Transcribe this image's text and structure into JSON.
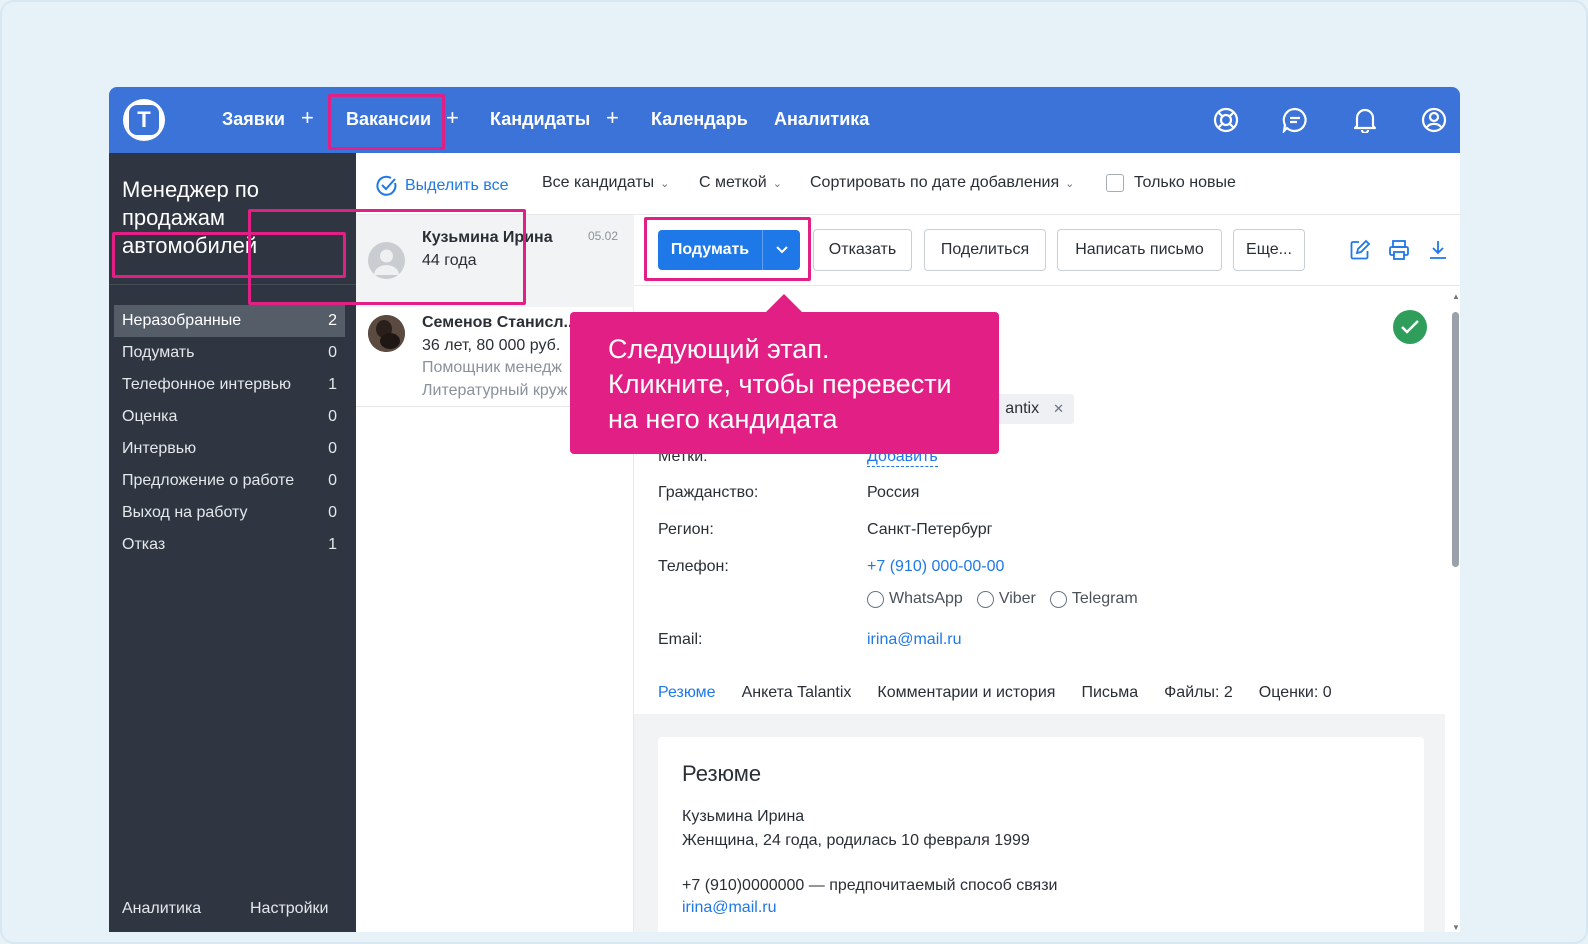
{
  "colors": {
    "accent": "#3b73d9",
    "primary_button": "#1f78e8",
    "highlight": "#e21f85",
    "sidebar": "#2f3641",
    "success": "#2f9e5b"
  },
  "logo": {
    "letter": "T"
  },
  "nav": {
    "items": [
      {
        "label": "Заявки"
      },
      {
        "label": "Вакансии"
      },
      {
        "label": "Кандидаты"
      },
      {
        "label": "Календарь"
      },
      {
        "label": "Аналитика"
      }
    ],
    "plus": "+",
    "icons": [
      "support-icon",
      "chat-icon",
      "bell-icon",
      "user-icon"
    ]
  },
  "sidebar": {
    "title": "Менеджер по продажам автомобилей",
    "stages": [
      {
        "label": "Неразобранные",
        "count": "2"
      },
      {
        "label": "Подумать",
        "count": "0"
      },
      {
        "label": "Телефонное интервью",
        "count": "1"
      },
      {
        "label": "Оценка",
        "count": "0"
      },
      {
        "label": "Интервью",
        "count": "0"
      },
      {
        "label": "Предложение о работе",
        "count": "0"
      },
      {
        "label": "Выход на работу",
        "count": "0"
      },
      {
        "label": "Отказ",
        "count": "1"
      }
    ],
    "footer": {
      "analytics": "Аналитика",
      "settings": "Настройки"
    }
  },
  "filters": {
    "select_all": "Выделить все",
    "all_candidates": "Все кандидаты",
    "with_tag": "С меткой",
    "sort": "Сортировать по дате добавления",
    "only_new": "Только новые"
  },
  "candidates": [
    {
      "name": "Кузьмина Ирина",
      "sub": "44 года",
      "date": "05.02"
    },
    {
      "name": "Семенов Станисл...",
      "sub": "36 лет, 80 000 руб.",
      "line3": "Помощник менедж",
      "line4": "Литературный круж"
    }
  ],
  "actions": {
    "primary": "Подумать",
    "reject": "Отказать",
    "share": "Поделиться",
    "write": "Написать письмо",
    "more": "Еще..."
  },
  "tooltip": {
    "line1": "Следующий этап.",
    "line2": "Кликните, чтобы перевести",
    "line3": "на него кандидата"
  },
  "detail": {
    "tag_partial": "antix",
    "tags_label": "Метки:",
    "tags_add": "Добавить",
    "citizenship_label": "Гражданство:",
    "citizenship": "Россия",
    "region_label": "Регион:",
    "region": "Санкт-Петербург",
    "phone_label": "Телефон:",
    "phone": "+7 (910) 000-00-00",
    "messengers": [
      "WhatsApp",
      "Viber",
      "Telegram"
    ],
    "email_label": "Email:",
    "email": "irina@mail.ru",
    "tabs": [
      "Резюме",
      "Анкета Talantix",
      "Комментарии и история",
      "Письма",
      "Файлы: 2",
      "Оценки: 0"
    ],
    "resume": {
      "heading": "Резюме",
      "name": "Кузьмина Ирина",
      "info": "Женщина, 24 года, родилась 10 февраля 1999",
      "contact": "+7 (910)0000000 — предпочитаемый способ связи",
      "email": "irina@mail.ru"
    }
  }
}
